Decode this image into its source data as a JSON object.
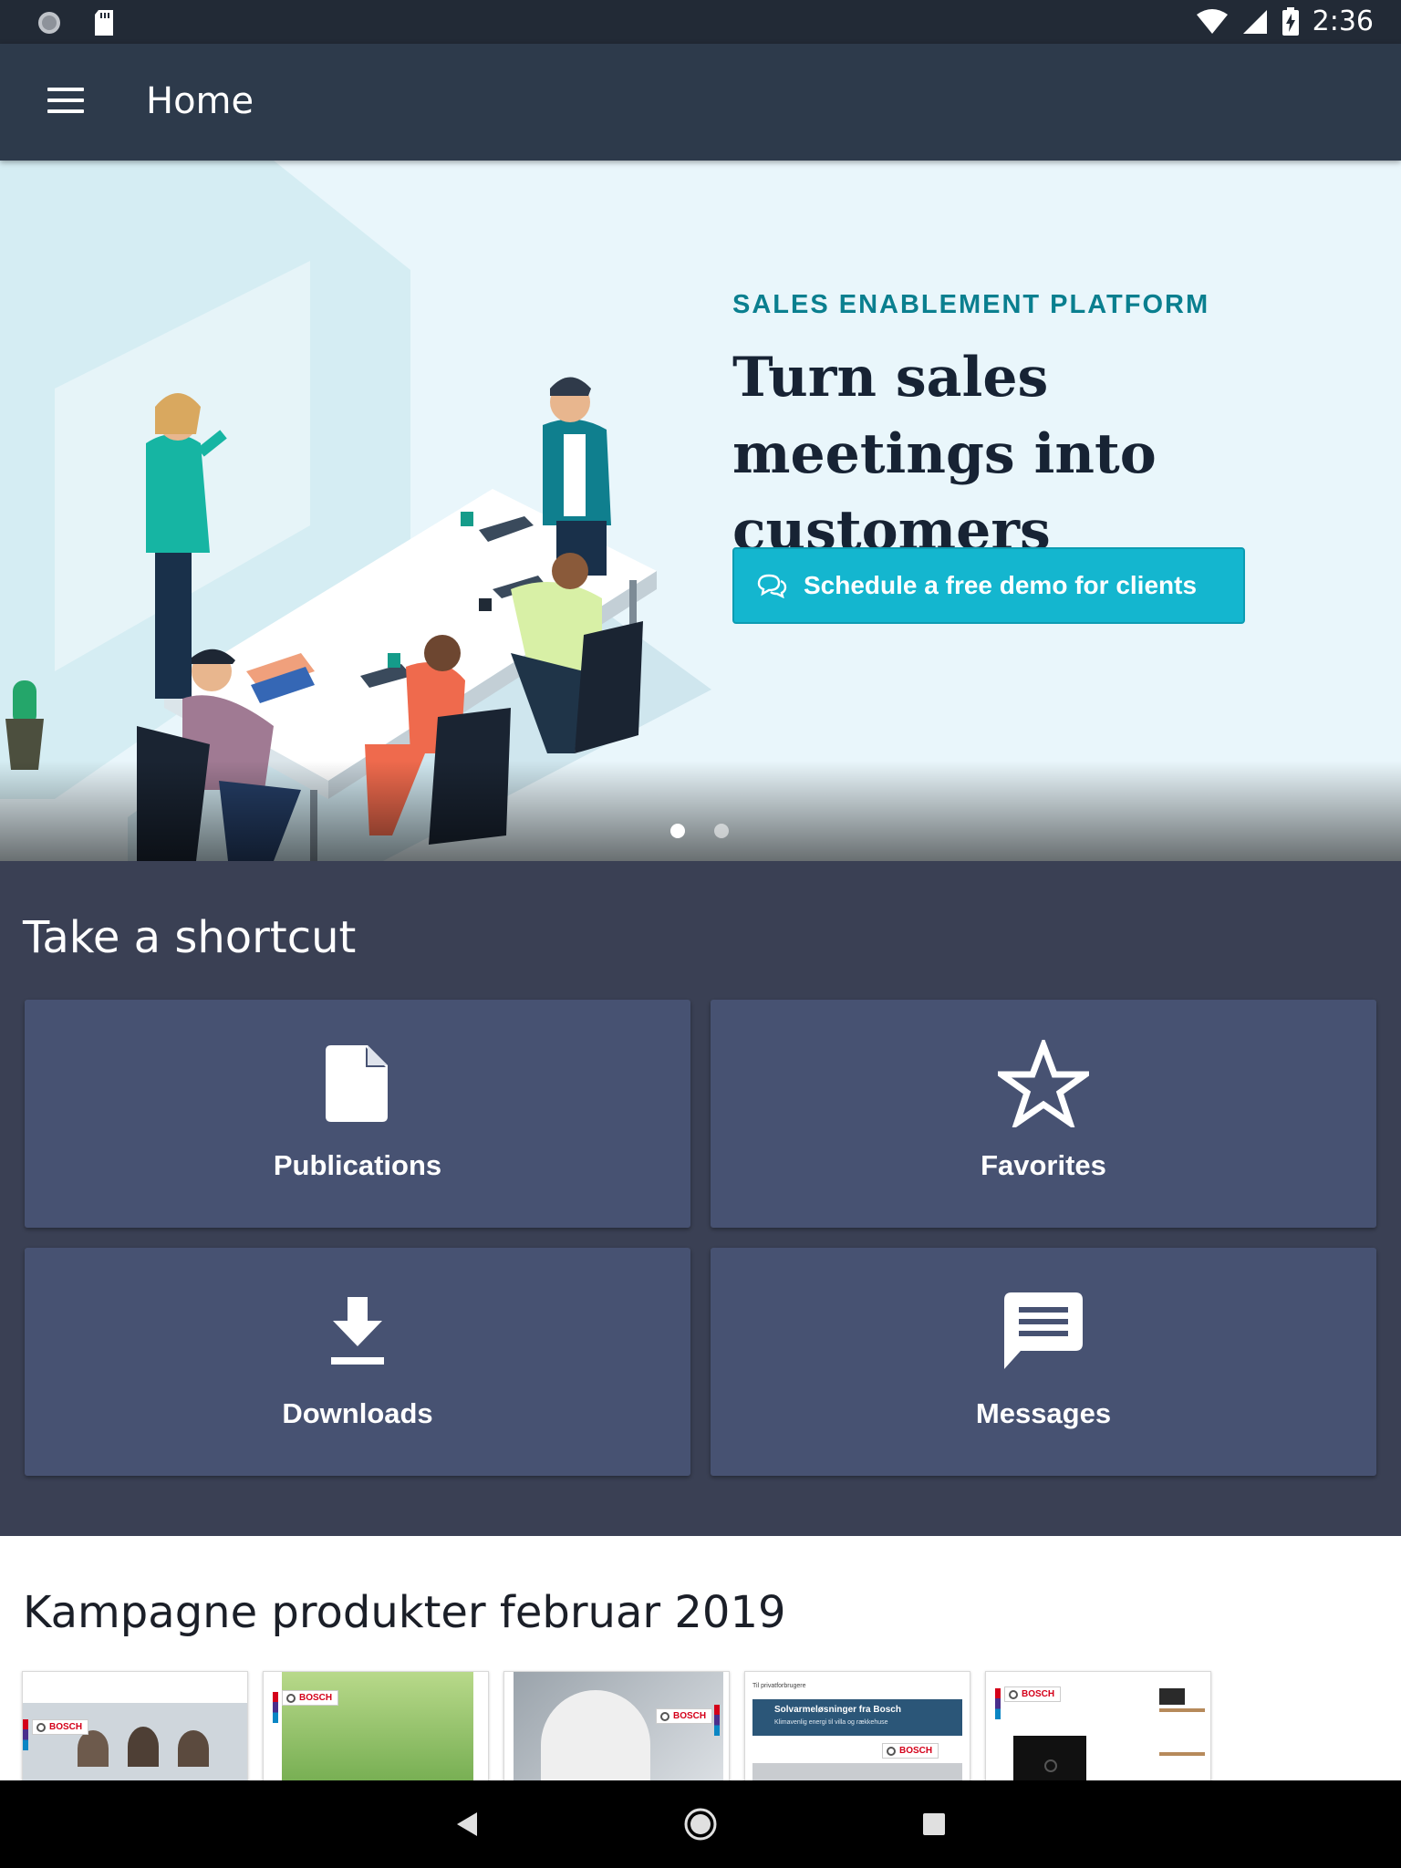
{
  "status_bar": {
    "time": "2:36",
    "left_icons": [
      "notification-dot-icon",
      "sd-card-icon"
    ],
    "right_icons": [
      "wifi-icon",
      "cell-signal-icon",
      "battery-charging-icon"
    ]
  },
  "app_bar": {
    "title": "Home",
    "menu_icon": "hamburger-menu-icon"
  },
  "hero": {
    "eyebrow": "SALES ENABLEMENT PLATFORM",
    "headline": "Turn sales meetings into customers",
    "cta_label": "Schedule a free demo for clients",
    "cta_icon": "chat-bubbles-icon",
    "carousel_pages": 2,
    "carousel_active": 1
  },
  "shortcuts": {
    "heading": "Take a shortcut",
    "tiles": [
      {
        "label": "Publications",
        "icon": "document-icon"
      },
      {
        "label": "Favorites",
        "icon": "star-outline-icon"
      },
      {
        "label": "Downloads",
        "icon": "download-icon"
      },
      {
        "label": "Messages",
        "icon": "message-icon"
      }
    ]
  },
  "campaign": {
    "heading": "Kampagne produkter februar 2019",
    "thumbnails": [
      {
        "brand": "BOSCH",
        "title": ""
      },
      {
        "brand": "BOSCH",
        "title": ""
      },
      {
        "brand": "BOSCH",
        "title": ""
      },
      {
        "brand": "BOSCH",
        "title": "Solvarmeløsninger fra Bosch",
        "subtitle": "Klimavenlig energi til villa og rækkehuse",
        "kicker": "Til privatforbrugere"
      },
      {
        "brand": "BOSCH",
        "title": ""
      }
    ]
  },
  "colors": {
    "status_bar": "#222a36",
    "app_bar": "#2d3a4b",
    "hero_bg": "#e9f6fb",
    "accent_teal": "#14b6cf",
    "eyebrow": "#0a7f8f",
    "shortcut_bg": "#3a4054",
    "tile_bg": "#475272"
  },
  "nav_bar": {
    "icons": [
      "back-icon",
      "home-icon",
      "recents-icon"
    ]
  }
}
